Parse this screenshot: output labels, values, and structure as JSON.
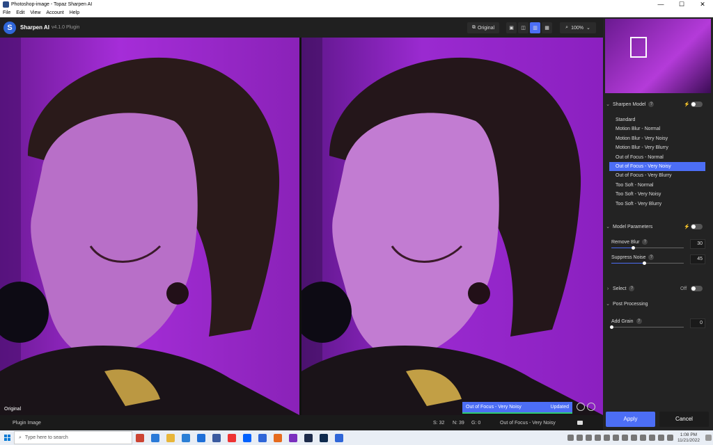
{
  "window": {
    "title": "Photoshop-image - Topaz Sharpen AI",
    "controls": [
      "—",
      "☐",
      "✕"
    ]
  },
  "menu": [
    "File",
    "Edit",
    "View",
    "Account",
    "Help"
  ],
  "header": {
    "brand": "Sharpen AI",
    "version": "v4.1.0 Plugin",
    "original_button": "Original",
    "zoom": "100%"
  },
  "preview": {
    "left_label": "Original",
    "status_model": "Out of Focus - Very Noisy",
    "status_state": "Updated"
  },
  "bottom": {
    "image_name": "Plugin Image",
    "s_label": "S:",
    "s_value": "32",
    "n_label": "N:",
    "n_value": "39",
    "g_label": "G:",
    "g_value": "0",
    "current_model": "Out of Focus - Very Noisy"
  },
  "sidebar": {
    "sharpen_model": {
      "title": "Sharpen Model",
      "items": [
        "Standard",
        "Motion Blur - Normal",
        "Motion Blur - Very Noisy",
        "Motion Blur - Very Blurry",
        "Out of Focus - Normal",
        "Out of Focus - Very Noisy",
        "Out of Focus - Very Blurry",
        "Too Soft - Normal",
        "Too Soft - Very Noisy",
        "Too Soft - Very Blurry"
      ],
      "selected_index": 5
    },
    "model_parameters": {
      "title": "Model Parameters",
      "remove_blur": {
        "label": "Remove Blur",
        "value": "30",
        "fraction": 0.3
      },
      "suppress_noise": {
        "label": "Suppress Noise",
        "value": "45",
        "fraction": 0.45
      }
    },
    "select": {
      "title": "Select",
      "state": "Off"
    },
    "post_processing": {
      "title": "Post Processing",
      "add_grain": {
        "label": "Add Grain",
        "value": "0",
        "fraction": 0
      }
    },
    "apply": "Apply",
    "cancel": "Cancel"
  },
  "taskbar": {
    "search_placeholder": "Type here to search",
    "time": "1:08 PM",
    "date": "11/21/2022"
  },
  "colors": {
    "accent": "#4c6ef5",
    "updated_bar": "#2ecc71"
  }
}
